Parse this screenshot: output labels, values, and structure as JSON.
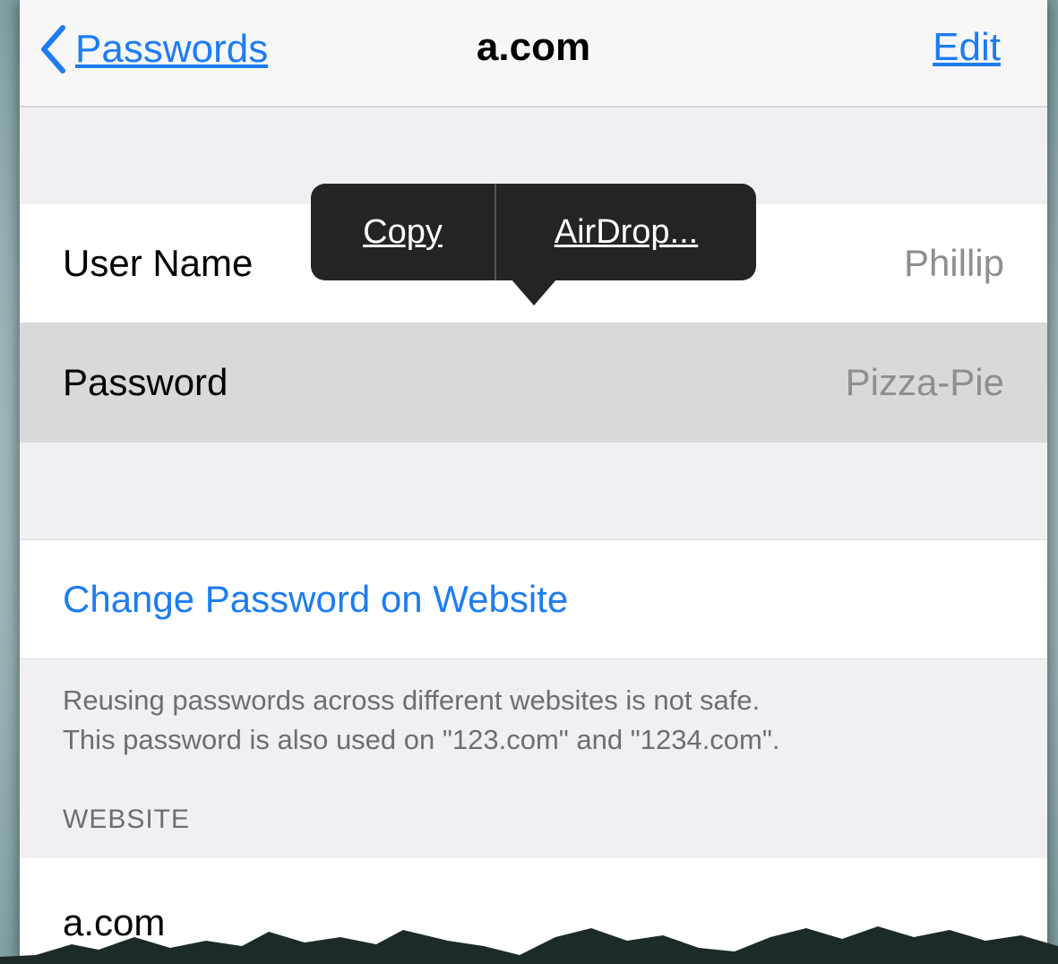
{
  "nav": {
    "back_label": "Passwords",
    "title": "a.com",
    "edit_label": "Edit"
  },
  "credentials": {
    "username_label": "User Name",
    "username_value": "Phillip",
    "password_label": "Password",
    "password_value": "Pizza-Pie"
  },
  "popover": {
    "copy_label": "Copy",
    "airdrop_label": "AirDrop..."
  },
  "actions": {
    "change_password_label": "Change Password on Website"
  },
  "warning": {
    "line1": "Reusing passwords across different websites is not safe.",
    "line2": "This password is also used on \"123.com\" and \"1234.com\"."
  },
  "website_section": {
    "header": "WEBSITE",
    "value": "a.com"
  },
  "icons": {
    "back": "chevron-left-icon"
  },
  "colors": {
    "accent": "#1d7cf2",
    "popover_bg": "#242424",
    "selected_row": "#d9d9d9"
  }
}
